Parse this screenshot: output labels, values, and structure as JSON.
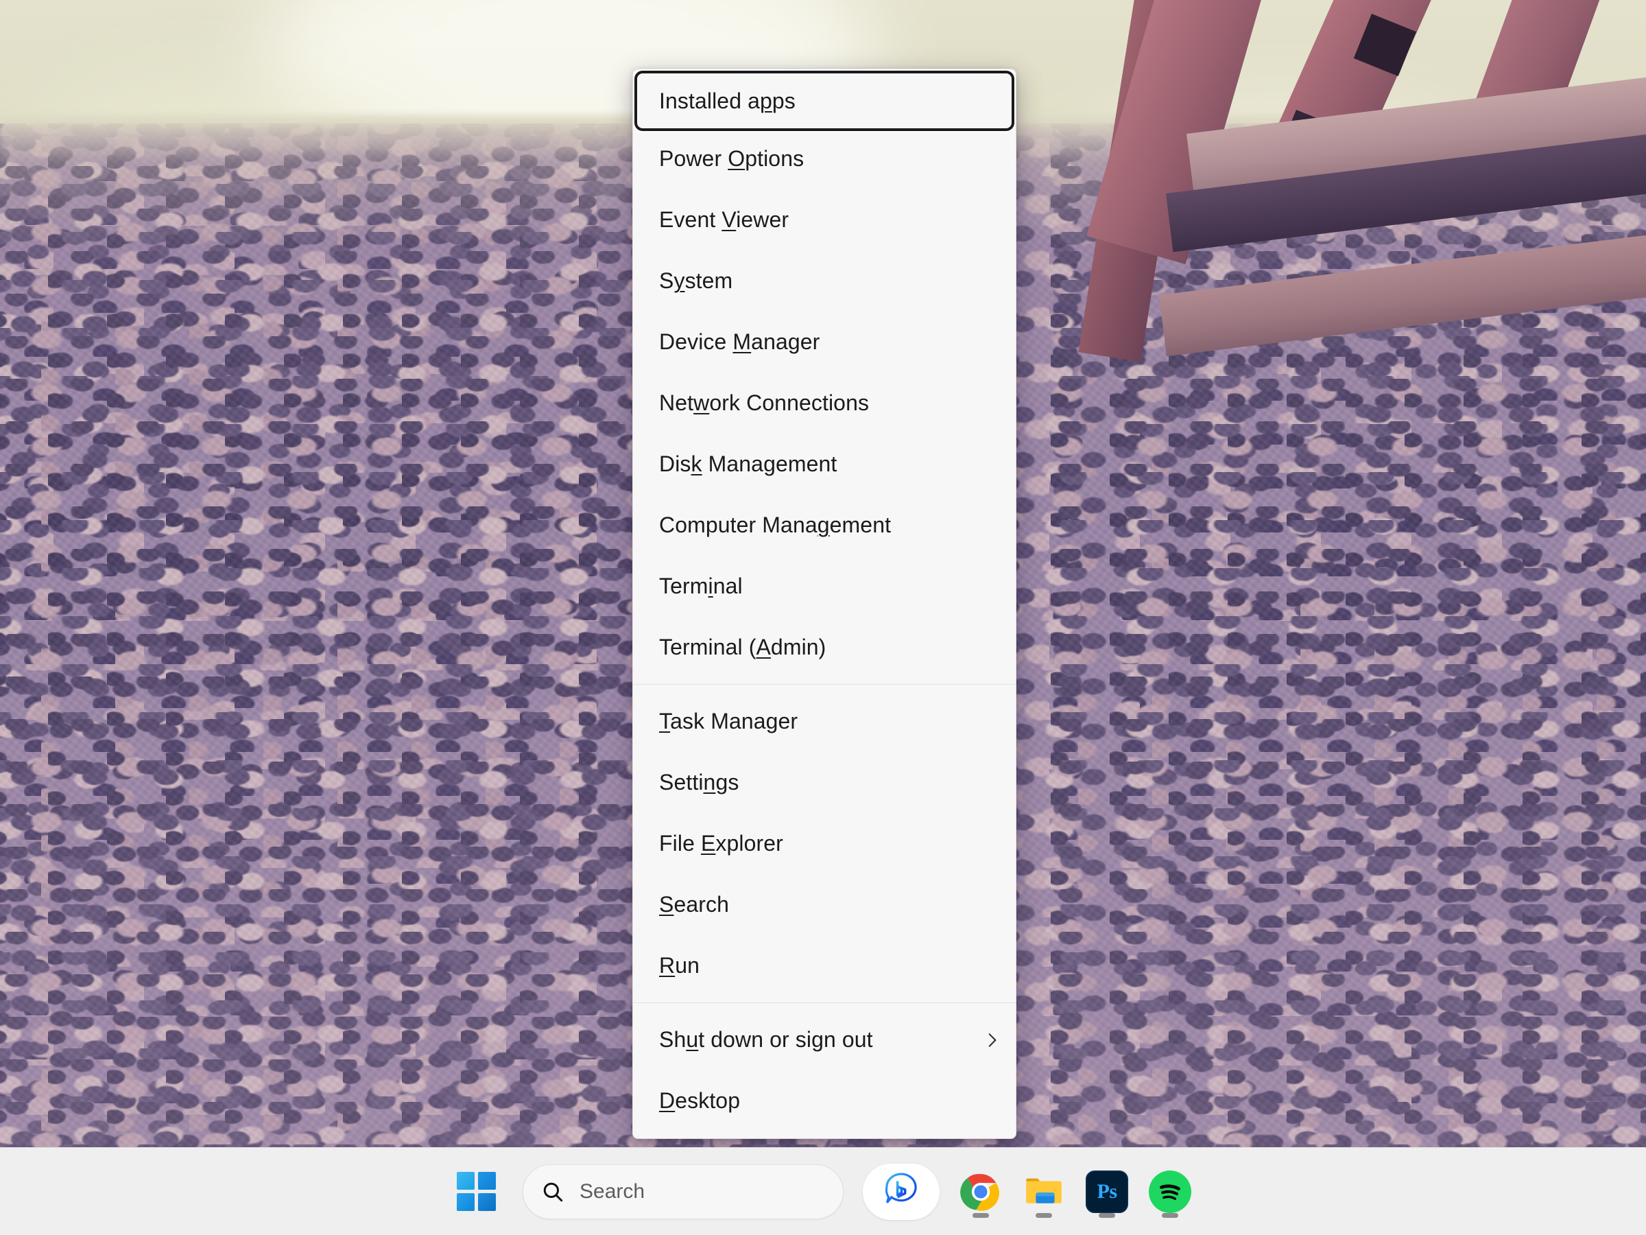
{
  "desktop": {
    "wallpaper_description": "Pebble beach with wooden structure",
    "sky_color": "#dcdac4",
    "pebble_color": "#9b87a8",
    "wood_color": "#a1656f"
  },
  "winx_menu": {
    "name": "Win+X quick link menu",
    "background": "#f7f7f7",
    "focus_ring_color": "#1a1a1a",
    "groups": [
      {
        "items": [
          {
            "label": "Installed apps",
            "pre": "Installed a",
            "accel": "p",
            "post": "ps",
            "focused": true,
            "submenu": false
          },
          {
            "label": "Power Options",
            "pre": "Power ",
            "accel": "O",
            "post": "ptions",
            "focused": false,
            "submenu": false
          },
          {
            "label": "Event Viewer",
            "pre": "Event ",
            "accel": "V",
            "post": "iewer",
            "focused": false,
            "submenu": false
          },
          {
            "label": "System",
            "pre": "S",
            "accel": "y",
            "post": "stem",
            "focused": false,
            "submenu": false
          },
          {
            "label": "Device Manager",
            "pre": "Device ",
            "accel": "M",
            "post": "anager",
            "focused": false,
            "submenu": false
          },
          {
            "label": "Network Connections",
            "pre": "Net",
            "accel": "w",
            "post": "ork Connections",
            "focused": false,
            "submenu": false
          },
          {
            "label": "Disk Management",
            "pre": "Dis",
            "accel": "k",
            "post": " Management",
            "focused": false,
            "submenu": false
          },
          {
            "label": "Computer Management",
            "pre": "Computer Mana",
            "accel": "g",
            "post": "ement",
            "focused": false,
            "submenu": false
          },
          {
            "label": "Terminal",
            "pre": "Term",
            "accel": "i",
            "post": "nal",
            "focused": false,
            "submenu": false
          },
          {
            "label": "Terminal (Admin)",
            "pre": "Terminal (",
            "accel": "A",
            "post": "dmin)",
            "focused": false,
            "submenu": false
          }
        ]
      },
      {
        "items": [
          {
            "label": "Task Manager",
            "pre": "",
            "accel": "T",
            "post": "ask Manager",
            "focused": false,
            "submenu": false
          },
          {
            "label": "Settings",
            "pre": "Setti",
            "accel": "n",
            "post": "gs",
            "focused": false,
            "submenu": false
          },
          {
            "label": "File Explorer",
            "pre": "File ",
            "accel": "E",
            "post": "xplorer",
            "focused": false,
            "submenu": false
          },
          {
            "label": "Search",
            "pre": "",
            "accel": "S",
            "post": "earch",
            "focused": false,
            "submenu": false
          },
          {
            "label": "Run",
            "pre": "",
            "accel": "R",
            "post": "un",
            "focused": false,
            "submenu": false
          }
        ]
      },
      {
        "items": [
          {
            "label": "Shut down or sign out",
            "pre": "Sh",
            "accel": "u",
            "post": "t down or sign out",
            "focused": false,
            "submenu": true
          },
          {
            "label": "Desktop",
            "pre": "",
            "accel": "D",
            "post": "esktop",
            "focused": false,
            "submenu": false
          }
        ]
      }
    ]
  },
  "taskbar": {
    "background": "#efefef",
    "start_button": {
      "name": "Start",
      "icon": "windows-logo-icon"
    },
    "search": {
      "placeholder": "Search",
      "icon": "search-icon"
    },
    "apps": [
      {
        "name": "Bing Chat",
        "icon": "bing-chat-icon",
        "running": false,
        "pinned": true
      },
      {
        "name": "Google Chrome",
        "icon": "chrome-icon",
        "running": true,
        "pinned": true
      },
      {
        "name": "File Explorer",
        "icon": "file-explorer-icon",
        "running": true,
        "pinned": true
      },
      {
        "name": "Adobe Photoshop",
        "icon": "photoshop-icon",
        "label": "Ps",
        "running": true,
        "pinned": true
      },
      {
        "name": "Spotify",
        "icon": "spotify-icon",
        "running": true,
        "pinned": true
      }
    ]
  }
}
